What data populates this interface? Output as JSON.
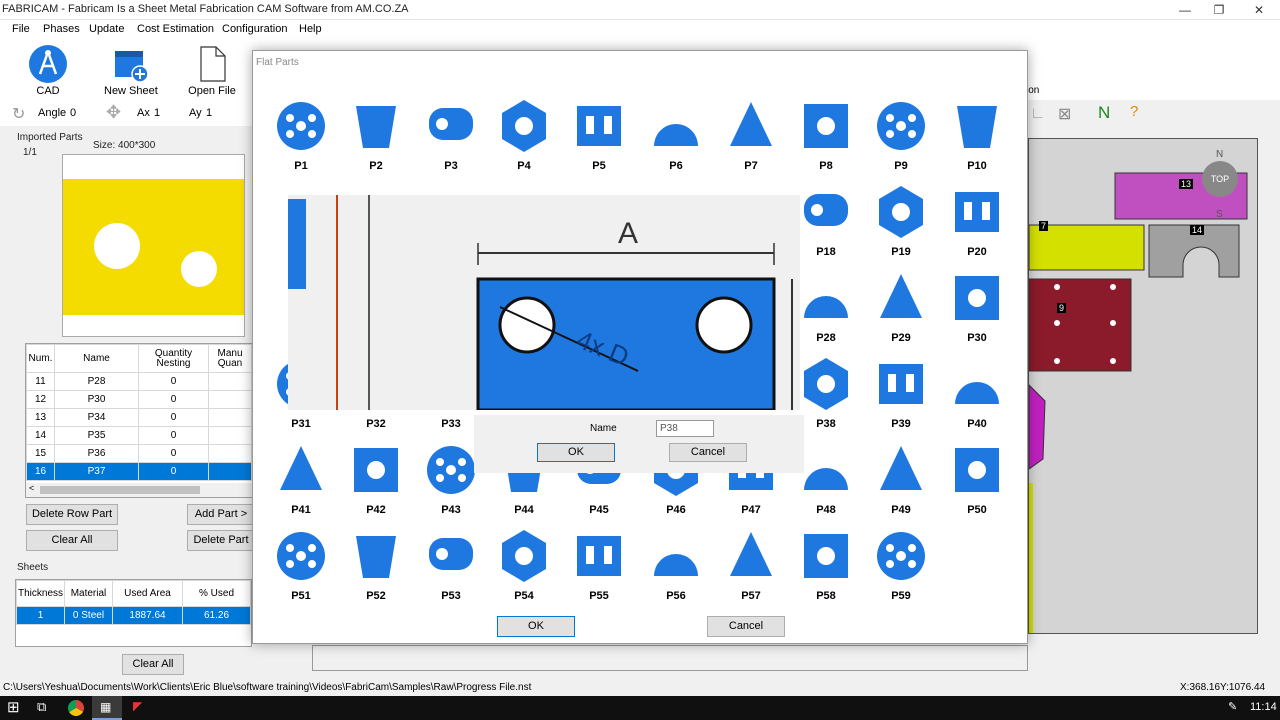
{
  "window": {
    "title": "FABRICAM - Fabricam Is a Sheet Metal Fabrication CAM Software from AM.CO.ZA",
    "min": "—",
    "max": "❐",
    "close": "✕"
  },
  "menu": [
    "File",
    "Phases",
    "Update",
    "Cost Estimation",
    "Configuration",
    "Help"
  ],
  "toolbar": {
    "cad": "CAD",
    "new_sheet": "New Sheet",
    "open_file": "Open File"
  },
  "options": {
    "angle_label": "Angle",
    "angle_value": "0",
    "ax_label": "Ax",
    "ax_value": "1",
    "ay_label": "Ay",
    "ay_value": "1"
  },
  "imported_parts": {
    "label": "Imported Parts",
    "page": "1/1",
    "size": "Size: 400*300"
  },
  "parts_table": {
    "headers": [
      "Num.",
      "Name",
      "Quantity Nesting",
      "Manu Quan"
    ],
    "rows": [
      [
        "11",
        "P28",
        "0"
      ],
      [
        "12",
        "P30",
        "0"
      ],
      [
        "13",
        "P34",
        "0"
      ],
      [
        "14",
        "P35",
        "0"
      ],
      [
        "15",
        "P36",
        "0"
      ],
      [
        "16",
        "P37",
        "0"
      ]
    ]
  },
  "left_buttons": {
    "delete_row": "Delete Row Part",
    "add_part": "Add Part >",
    "clear_all": "Clear All",
    "delete_part": "Delete Part"
  },
  "sheets": {
    "label": "Sheets",
    "headers": [
      "Thickness",
      "Material",
      "Used Area",
      "% Used"
    ],
    "rows": [
      [
        "1",
        "0",
        "Steel",
        "1887.64",
        "61.26"
      ]
    ],
    "clear_all": "Clear All"
  },
  "canvas": {
    "compass_n": "N",
    "compass_s": "S",
    "top_btn": "TOP",
    "labels": [
      "13",
      "7",
      "14",
      "9"
    ],
    "tool_text": "ion"
  },
  "flat_parts": {
    "title": "Flat Parts",
    "parts": [
      "P1",
      "P2",
      "P3",
      "P4",
      "P5",
      "P6",
      "P7",
      "P8",
      "P9",
      "P10",
      "P18",
      "P19",
      "P20",
      "P28",
      "P29",
      "P30",
      "P31",
      "P32",
      "P33",
      "P38",
      "P39",
      "P40",
      "P41",
      "P42",
      "P43",
      "P44",
      "P45",
      "P46",
      "P47",
      "P48",
      "P49",
      "P50",
      "P51",
      "P52",
      "P53",
      "P54",
      "P55",
      "P56",
      "P57",
      "P58",
      "P59"
    ],
    "ok": "OK",
    "cancel": "Cancel"
  },
  "name_dialog": {
    "name_label": "Name",
    "name_value": "P38",
    "ok": "OK",
    "cancel": "Cancel",
    "dim_a": "A",
    "dim_d": "4x D"
  },
  "status": {
    "path": "C:\\Users\\Yeshua\\Documents\\Work\\Clients\\Eric Blue\\software training\\Videos\\FabriCam\\Samples\\Raw\\Progress File.nst",
    "coords": "X:368.16Y:1076.44"
  },
  "taskbar": {
    "time": "11:14"
  },
  "colors": {
    "part_blue": "#1e78e0",
    "selection": "#0078d7",
    "yellow": "#f5dc00"
  }
}
